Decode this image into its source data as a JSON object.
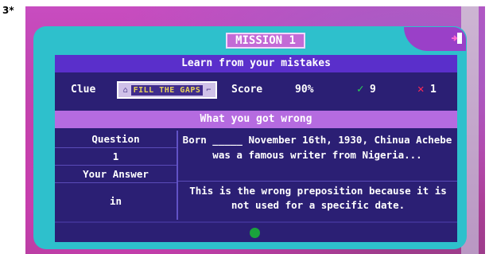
{
  "corner_label": "3*",
  "mission": {
    "title": "MISSION 1"
  },
  "panel": {
    "subtitle": "Learn from your mistakes",
    "clue": {
      "label": "Clue",
      "badge_text": "FILL THE GAPS",
      "badge_icon": "tag-icon"
    },
    "score": {
      "label": "Score",
      "value": "90%"
    },
    "correct": {
      "icon": "check-icon",
      "count": "9",
      "color": "#2ad357"
    },
    "wrong": {
      "icon": "cross-icon",
      "count": "1",
      "color": "#ff2a55"
    },
    "wrong_header": "What you got wrong",
    "question_label": "Question",
    "question_number": "1",
    "question_text": "Born _____ November 16th, 1930, Chinua Achebe was a famous writer from Nigeria...",
    "your_answer_label": "Your Answer",
    "your_answer_value": "in",
    "explanation": "This is the wrong preposition because it is not used for a specific date."
  },
  "exit_icon": "exit-icon",
  "progress": {
    "dot_color": "#1aa23c"
  }
}
